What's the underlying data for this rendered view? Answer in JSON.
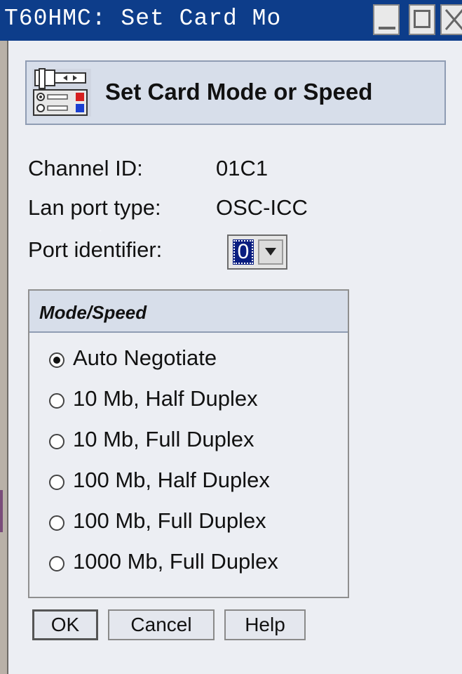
{
  "window": {
    "title": "T60HMC: Set Card Mo"
  },
  "header": {
    "title": "Set Card Mode or Speed",
    "icon": "network-card-settings-icon"
  },
  "info": {
    "channel_id_label": "Channel ID:",
    "channel_id_value": "01C1",
    "lan_port_type_label": "Lan port type:",
    "lan_port_type_value": "OSC-ICC",
    "port_identifier_label": "Port identifier:",
    "port_identifier_value": "0"
  },
  "mode_speed": {
    "title": "Mode/Speed",
    "selected": "Auto Negotiate",
    "options": [
      "Auto Negotiate",
      "10 Mb, Half Duplex",
      "10 Mb, Full Duplex",
      "100 Mb, Half Duplex",
      "100 Mb, Full Duplex",
      "1000 Mb, Full Duplex"
    ]
  },
  "buttons": {
    "ok": "OK",
    "cancel": "Cancel",
    "help": "Help"
  },
  "colors": {
    "titlebar": "#0d3d8a",
    "panel_header": "#d7deea",
    "background": "#eceef3",
    "selection": "#0a1e80"
  }
}
